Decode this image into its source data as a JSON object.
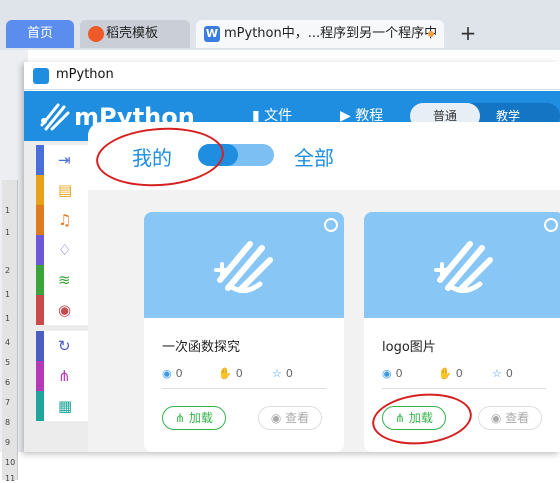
{
  "browser": {
    "tabs": [
      {
        "label": "首页"
      },
      {
        "label": "稻壳模板"
      },
      {
        "label": "mPython中，...程序到另一个程序中"
      }
    ],
    "new_tab_label": "+"
  },
  "wps": {
    "ruler_numbers": [
      "1",
      "1",
      "2",
      "1",
      "1",
      "4",
      "5",
      "6",
      "7",
      "8",
      "9",
      "10",
      "11"
    ]
  },
  "mpython": {
    "window_title": "mPython",
    "logo_text": "mPython",
    "header": {
      "file_label": "文件",
      "tutorial_label": "教程",
      "mode_normal": "普通",
      "mode_teach": "教学"
    },
    "palette": [
      {
        "icon": "sign-in-icon",
        "glyph": "⇥",
        "color": "#4a6fd8"
      },
      {
        "icon": "display-icon",
        "glyph": "▤",
        "color": "#e6a31a"
      },
      {
        "icon": "music-icon",
        "glyph": "♫",
        "color": "#e07a1f"
      },
      {
        "icon": "bulb-icon",
        "glyph": "♢",
        "color": "#6f58d6"
      },
      {
        "icon": "wifi-icon",
        "glyph": "≋",
        "color": "#3ca33c"
      },
      {
        "icon": "radio-icon",
        "glyph": "◉",
        "color": "#c84a4a"
      },
      {
        "icon": "loop-icon",
        "glyph": "↻",
        "color": "#4a5fc0"
      },
      {
        "icon": "tree-icon",
        "glyph": "⋔",
        "color": "#b53ab5"
      },
      {
        "icon": "calc-icon",
        "glyph": "▦",
        "color": "#1fa59a"
      }
    ]
  },
  "panel": {
    "filter_mine": "我的",
    "filter_all": "全部",
    "cards": [
      {
        "title": "一次函数探究",
        "views": "0",
        "likes": "0",
        "stars": "0",
        "load_label": "加载",
        "view_label": "查看"
      },
      {
        "title": "logo图片",
        "views": "0",
        "likes": "0",
        "stars": "0",
        "load_label": "加载",
        "view_label": "查看"
      }
    ]
  },
  "colors": {
    "brand_blue": "#1f8ee0",
    "card_thumb": "#87c6f5",
    "load_green": "#35b24a",
    "annotation_red": "#d62020"
  }
}
